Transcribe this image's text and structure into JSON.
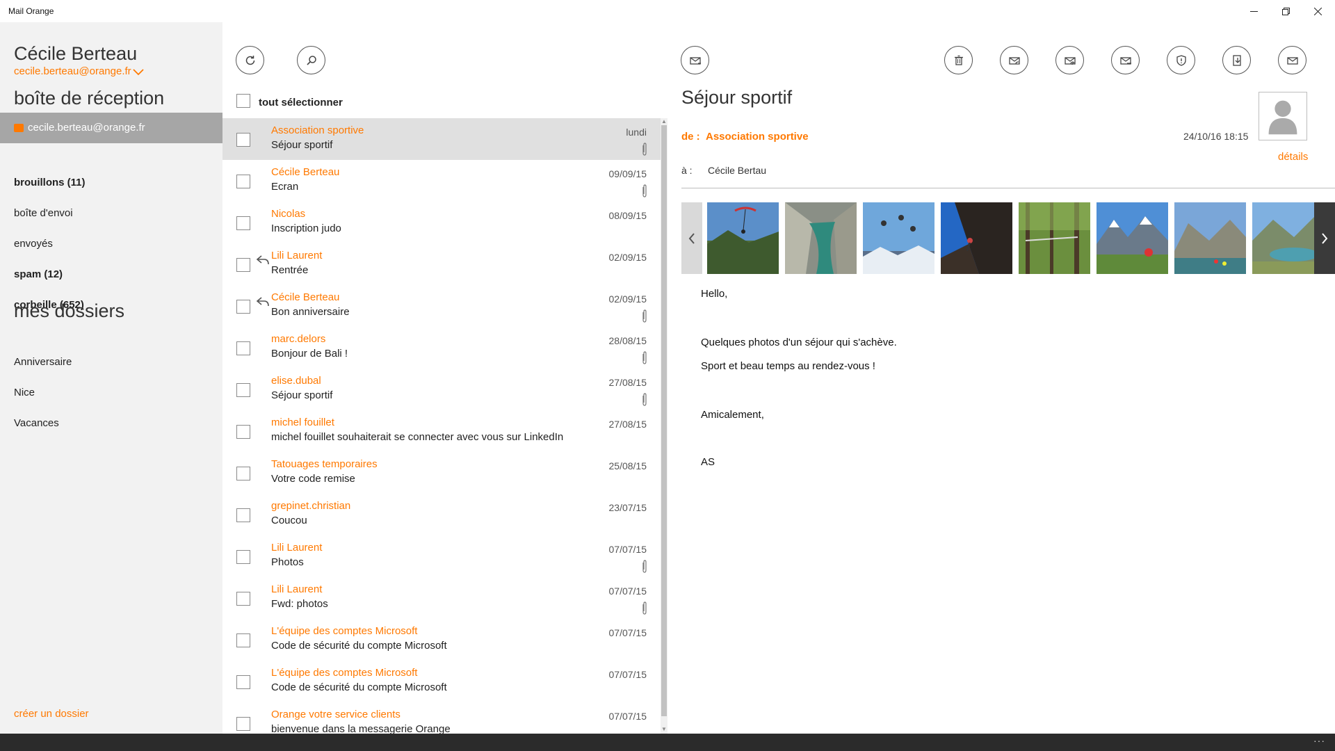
{
  "window": {
    "title": "Mail Orange"
  },
  "account": {
    "name": "Cécile Berteau",
    "email": "cecile.berteau@orange.fr"
  },
  "sidebar": {
    "inbox_heading": "boîte de réception",
    "selected_mailbox": "cecile.berteau@orange.fr",
    "folders": [
      {
        "label": "brouillons (11)",
        "bold": true
      },
      {
        "label": "boîte d'envoi",
        "bold": false
      },
      {
        "label": "envoyés",
        "bold": false
      },
      {
        "label": "spam (12)",
        "bold": true
      },
      {
        "label": "corbeille (652)",
        "bold": true
      }
    ],
    "my_folders_heading": "mes dossiers",
    "my_folders": [
      "Anniversaire",
      "Nice",
      "Vacances"
    ],
    "create_folder": "créer un dossier"
  },
  "list": {
    "select_all": "tout sélectionner",
    "messages": [
      {
        "sender": "Association sportive",
        "subject": "Séjour sportif",
        "date": "lundi",
        "attachment": true,
        "replied": false,
        "selected": true
      },
      {
        "sender": "Cécile Berteau",
        "subject": "Ecran",
        "date": "09/09/15",
        "attachment": true,
        "replied": false
      },
      {
        "sender": "Nicolas",
        "subject": "Inscription judo",
        "date": "08/09/15",
        "attachment": false,
        "replied": false
      },
      {
        "sender": "Lili Laurent",
        "subject": "Rentrée",
        "date": "02/09/15",
        "attachment": false,
        "replied": true
      },
      {
        "sender": "Cécile Berteau",
        "subject": "Bon anniversaire",
        "date": "02/09/15",
        "attachment": true,
        "replied": true
      },
      {
        "sender": "marc.delors",
        "subject": "Bonjour de Bali !",
        "date": "28/08/15",
        "attachment": true,
        "replied": false
      },
      {
        "sender": "elise.dubal",
        "subject": "Séjour sportif",
        "date": "27/08/15",
        "attachment": true,
        "replied": false
      },
      {
        "sender": "michel fouillet",
        "subject": "michel fouillet souhaiterait se connecter avec vous sur LinkedIn",
        "date": "27/08/15",
        "attachment": false,
        "replied": false
      },
      {
        "sender": "Tatouages temporaires",
        "subject": "Votre code remise",
        "date": "25/08/15",
        "attachment": false,
        "replied": false
      },
      {
        "sender": "grepinet.christian",
        "subject": "Coucou",
        "date": "23/07/15",
        "attachment": false,
        "replied": false
      },
      {
        "sender": "Lili Laurent",
        "subject": "Photos",
        "date": "07/07/15",
        "attachment": true,
        "replied": false
      },
      {
        "sender": "Lili Laurent",
        "subject": "Fwd: photos",
        "date": "07/07/15",
        "attachment": true,
        "replied": false
      },
      {
        "sender": "L'équipe des comptes Microsoft",
        "subject": "Code de sécurité du compte Microsoft",
        "date": "07/07/15",
        "attachment": false,
        "replied": false
      },
      {
        "sender": "L'équipe des comptes Microsoft",
        "subject": "Code de sécurité du compte Microsoft",
        "date": "07/07/15",
        "attachment": false,
        "replied": false
      },
      {
        "sender": "Orange votre service clients",
        "subject": "bienvenue dans la messagerie Orange",
        "date": "07/07/15",
        "attachment": false,
        "replied": false
      }
    ]
  },
  "reader": {
    "subject": "Séjour sportif",
    "from_label": "de :",
    "from": "Association sportive",
    "date": "24/10/16 18:15",
    "details": "détails",
    "to_label": "à :",
    "to": "Cécile Bertau",
    "body": [
      "Hello,",
      "Quelques photos d'un séjour qui s'achève.",
      "Sport et beau temps au rendez-vous !",
      "Amicalement,",
      "AS"
    ]
  },
  "colors": {
    "accent": "#ff7900",
    "sidebar_bg": "#f2f2f2",
    "selected_folder": "#a6a6a6",
    "selected_row": "#e0e0e0"
  },
  "icons": {
    "list_toolbar": [
      "refresh-icon",
      "search-icon"
    ],
    "reader_toolbar": [
      "new-message-icon",
      "delete-icon",
      "reply-icon",
      "reply-all-icon",
      "forward-icon",
      "spam-icon",
      "move-icon",
      "mark-unread-icon"
    ]
  },
  "gallery_photos": [
    "paragliding-photo",
    "canyoning-photo",
    "skydiving-photo",
    "climbing-photo",
    "treetop-course-photo",
    "mountain-biking-photo",
    "kayaking-photo",
    "mountain-lake-photo"
  ]
}
